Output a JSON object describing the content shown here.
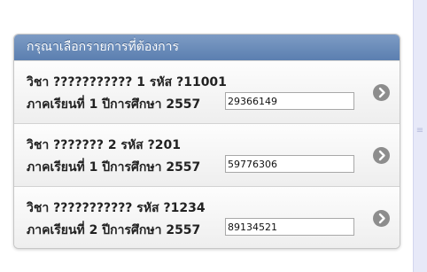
{
  "panel": {
    "header": "กรุณาเลือกรายการที่ต้องการ",
    "items": [
      {
        "title": "วิชา ??????????? 1 รหัส ?11001",
        "term": "ภาคเรียนที่ 1 ปีการศึกษา 2557",
        "code": "29366149",
        "icon": "chevron-right-circle-icon"
      },
      {
        "title": "วิชา ??????? 2 รหัส ?201",
        "term": "ภาคเรียนที่ 1 ปีการศึกษา 2557",
        "code": "59776306",
        "icon": "chevron-right-circle-icon"
      },
      {
        "title": "วิชา ??????????? รหัส ?1234",
        "term": "ภาคเรียนที่ 2 ปีการศึกษา 2557",
        "code": "89134521",
        "icon": "chevron-right-circle-icon"
      }
    ]
  },
  "colors": {
    "header_bg": "#6b8dbc",
    "chevron": "#8d8d8d",
    "scrollbar": "#e7e9f8"
  }
}
